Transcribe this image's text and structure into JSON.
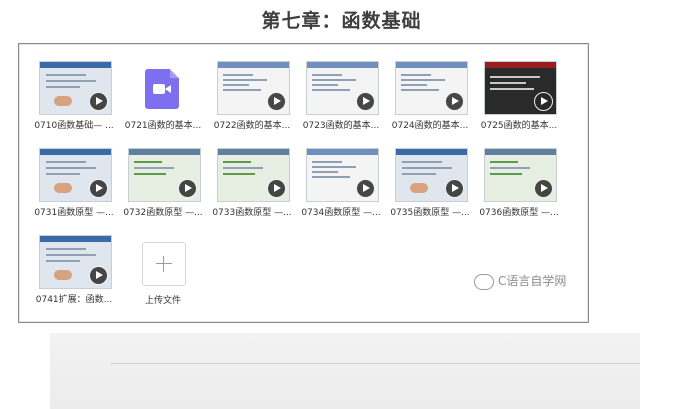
{
  "page": {
    "title": "第七章：函数基础"
  },
  "files": [
    {
      "label": "0710函数基础— ...",
      "kind": "video",
      "thumb": "slide"
    },
    {
      "label": "0721函数的基本...",
      "kind": "video-file",
      "thumb": "icon"
    },
    {
      "label": "0722函数的基本...",
      "kind": "video",
      "thumb": "white"
    },
    {
      "label": "0723函数的基本...",
      "kind": "video",
      "thumb": "white"
    },
    {
      "label": "0724函数的基本...",
      "kind": "video",
      "thumb": "white"
    },
    {
      "label": "0725函数的基本...",
      "kind": "video",
      "thumb": "dark"
    },
    {
      "label": "0731函数原型 —...",
      "kind": "video",
      "thumb": "slide"
    },
    {
      "label": "0732函数原型 —...",
      "kind": "video",
      "thumb": "green"
    },
    {
      "label": "0733函数原型 —...",
      "kind": "video",
      "thumb": "green"
    },
    {
      "label": "0734函数原型 —...",
      "kind": "video",
      "thumb": "white"
    },
    {
      "label": "0735函数原型 —...",
      "kind": "video",
      "thumb": "slide"
    },
    {
      "label": "0736函数原型 —...",
      "kind": "video",
      "thumb": "green"
    },
    {
      "label": "0741扩展：函数...",
      "kind": "video",
      "thumb": "slide"
    }
  ],
  "upload": {
    "label": "上传文件"
  },
  "watermark": {
    "text": "C语言自学网"
  },
  "icons": {
    "play": "play-icon",
    "upload": "plus-icon",
    "video": "video-file-icon",
    "watermark": "wechat-icon"
  }
}
